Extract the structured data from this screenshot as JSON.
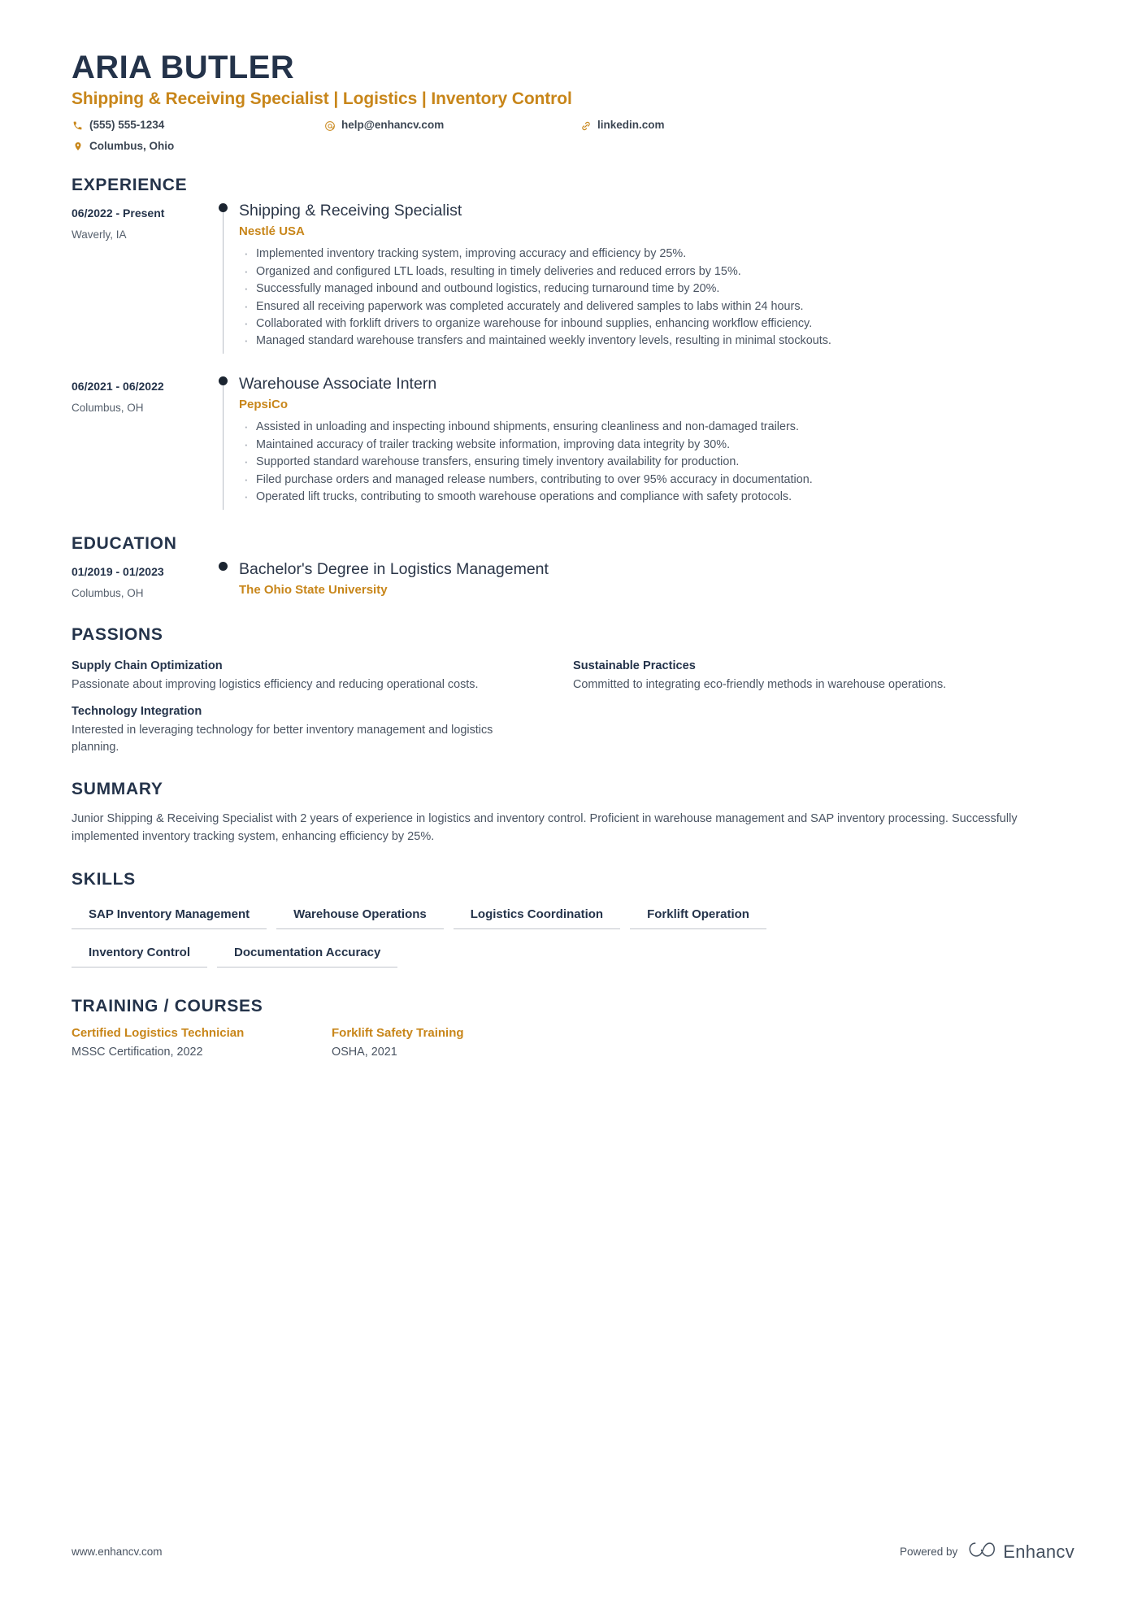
{
  "header": {
    "name": "ARIA BUTLER",
    "headline": "Shipping & Receiving Specialist | Logistics | Inventory Control",
    "contacts": [
      {
        "icon": "phone-icon",
        "text": "(555) 555-1234"
      },
      {
        "icon": "email-icon",
        "text": "help@enhancv.com"
      },
      {
        "icon": "link-icon",
        "text": "linkedin.com"
      },
      {
        "icon": "location-icon",
        "text": "Columbus, Ohio"
      }
    ]
  },
  "sections": {
    "experience_title": "EXPERIENCE",
    "education_title": "EDUCATION",
    "passions_title": "PASSIONS",
    "summary_title": "SUMMARY",
    "skills_title": "SKILLS",
    "training_title": "TRAINING / COURSES"
  },
  "experience": [
    {
      "date": "06/2022 - Present",
      "location": "Waverly, IA",
      "title": "Shipping & Receiving Specialist",
      "org": "Nestlé USA",
      "bullets": [
        "Implemented inventory tracking system, improving accuracy and efficiency by 25%.",
        "Organized and configured LTL loads, resulting in timely deliveries and reduced errors by 15%.",
        "Successfully managed inbound and outbound logistics, reducing turnaround time by 20%.",
        "Ensured all receiving paperwork was completed accurately and delivered samples to labs within 24 hours.",
        "Collaborated with forklift drivers to organize warehouse for inbound supplies, enhancing workflow efficiency.",
        "Managed standard warehouse transfers and maintained weekly inventory levels, resulting in minimal stockouts."
      ]
    },
    {
      "date": "06/2021 - 06/2022",
      "location": "Columbus, OH",
      "title": "Warehouse Associate Intern",
      "org": "PepsiCo",
      "bullets": [
        "Assisted in unloading and inspecting inbound shipments, ensuring cleanliness and non-damaged trailers.",
        "Maintained accuracy of trailer tracking website information, improving data integrity by 30%.",
        "Supported standard warehouse transfers, ensuring timely inventory availability for production.",
        "Filed purchase orders and managed release numbers, contributing to over 95% accuracy in documentation.",
        "Operated lift trucks, contributing to smooth warehouse operations and compliance with safety protocols."
      ]
    }
  ],
  "education": [
    {
      "date": "01/2019 - 01/2023",
      "location": "Columbus, OH",
      "title": "Bachelor's Degree in Logistics Management",
      "org": "The Ohio State University"
    }
  ],
  "passions": [
    {
      "title": "Supply Chain Optimization",
      "text": "Passionate about improving logistics efficiency and reducing operational costs."
    },
    {
      "title": "Sustainable Practices",
      "text": "Committed to integrating eco-friendly methods in warehouse operations."
    },
    {
      "title": "Technology Integration",
      "text": "Interested in leveraging technology for better inventory management and logistics planning."
    }
  ],
  "summary": {
    "text": "Junior Shipping & Receiving Specialist with 2 years of experience in logistics and inventory control. Proficient in warehouse management and SAP inventory processing. Successfully implemented inventory tracking system, enhancing efficiency by 25%."
  },
  "skills": [
    "SAP Inventory Management",
    "Warehouse Operations",
    "Logistics Coordination",
    "Forklift Operation",
    "Inventory Control",
    "Documentation Accuracy"
  ],
  "training": [
    {
      "title": "Certified Logistics Technician",
      "sub": "MSSC Certification, 2022"
    },
    {
      "title": "Forklift Safety Training",
      "sub": "OSHA, 2021"
    }
  ],
  "footer": {
    "url": "www.enhancv.com",
    "powered_by": "Powered by",
    "brand": "Enhancv"
  },
  "colors": {
    "accent": "#c8861a",
    "heading": "#24334a",
    "body": "#4a5462"
  }
}
